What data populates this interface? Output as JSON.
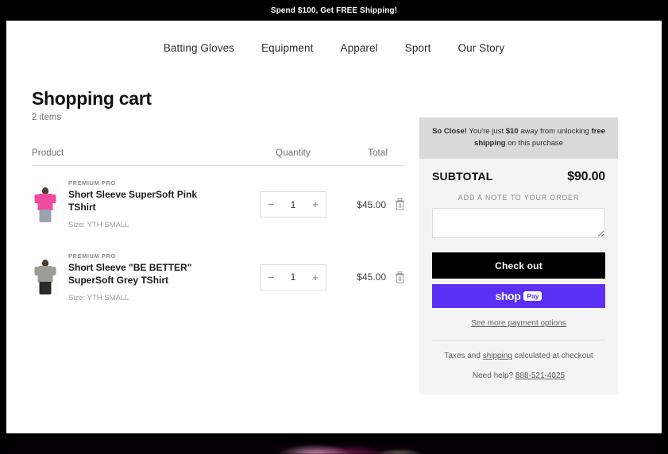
{
  "announcement": {
    "text": "Spend $100, Get FREE Shipping!"
  },
  "nav": {
    "items": [
      {
        "label": "Batting Gloves"
      },
      {
        "label": "Equipment"
      },
      {
        "label": "Apparel"
      },
      {
        "label": "Sport"
      },
      {
        "label": "Our Story"
      }
    ]
  },
  "cart": {
    "title": "Shopping cart",
    "count_label": "2 items",
    "headers": {
      "product": "Product",
      "quantity": "Quantity",
      "total": "Total"
    },
    "items": [
      {
        "vendor": "PREMIUM PRO",
        "name": "Short Sleeve SuperSoft Pink TShirt",
        "variant": "Size: YTH SMALL",
        "quantity": "1",
        "total": "$45.00",
        "decrease_label": "−",
        "increase_label": "+",
        "thumb_color": "#ef4ba0"
      },
      {
        "vendor": "PREMIUM PRO",
        "name": "Short Sleeve \"BE BETTER\" SuperSoft Grey TShirt",
        "variant": "Size: YTH SMALL",
        "quantity": "1",
        "total": "$45.00",
        "decrease_label": "−",
        "increase_label": "+",
        "thumb_color": "#9c9c96"
      }
    ]
  },
  "sidebar": {
    "free_shipping": {
      "lead": "So Close!",
      "text_1": " You're just ",
      "amount": "$10",
      "text_2": " away from unlocking ",
      "highlight": "free shipping",
      "text_3": " on this purchase"
    },
    "subtotal_label": "SUBTOTAL",
    "subtotal_value": "$90.00",
    "note_label": "ADD A NOTE TO YOUR ORDER",
    "note_value": "",
    "note_placeholder": "",
    "checkout_label": "Check out",
    "shop_pay": {
      "word": "shop",
      "chip": "Pay"
    },
    "more_payment_label": "See more payment options",
    "taxes_text_1": "Taxes and ",
    "taxes_link": "shipping",
    "taxes_text_2": " calculated at checkout",
    "help_text": "Need help? ",
    "help_phone": "888-521-4025"
  },
  "colors": {
    "accent_shop_pay": "#5a31f4",
    "announcement_bg": "#000000",
    "sidebar_bg": "#f4f4f4",
    "free_shipping_bg": "#d9d9d9"
  }
}
